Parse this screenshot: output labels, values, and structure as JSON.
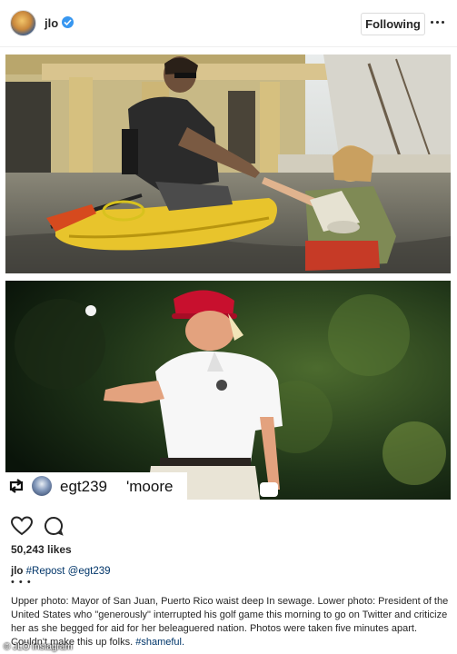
{
  "header": {
    "username": "jlo",
    "follow_label": "Following"
  },
  "photos": {
    "top_alt": "",
    "bottom_alt": ""
  },
  "repost_tag": {
    "username": "egt239",
    "extra": "'moore"
  },
  "actions": {
    "likes": "50,243 likes"
  },
  "caption": {
    "user": "jlo",
    "repost_tag": "#Repost",
    "mention": "@egt239",
    "body_part1": "Upper photo: Mayor of San Juan, Puerto Rico waist deep In sewage. Lower photo: President of the United States who \"generously\" interrupted his golf game this morning to go on Twitter and criticize her as she begged for aid for her beleaguered nation. Photos were taken five minutes apart. Couldn't make this up folks.",
    "hashtag": "#shameful."
  },
  "watermark": "© JLO Instagram",
  "colors": {
    "verified": "#3897f0",
    "link": "#003569",
    "border": "#dbdbdb"
  }
}
